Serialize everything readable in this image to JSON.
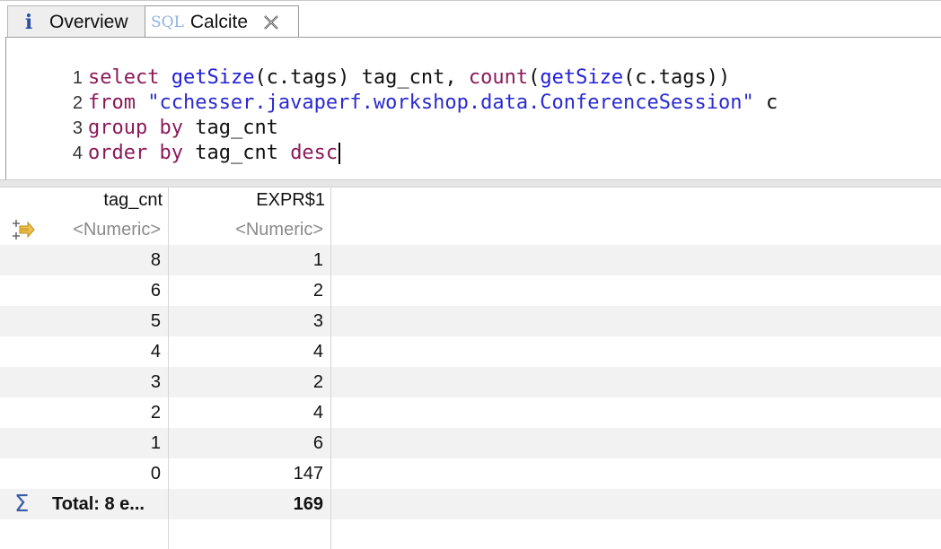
{
  "tabs": {
    "overview": {
      "icon": "info-icon",
      "label": "Overview"
    },
    "calcite": {
      "icon": "sql-icon",
      "icon_text": "SQL",
      "label": "Calcite"
    }
  },
  "editor": {
    "lines": [
      {
        "no": "1",
        "tokens": [
          "select",
          " ",
          "getSize",
          "(c.tags) tag_cnt, ",
          "count",
          "(",
          "getSize",
          "(c.tags))"
        ]
      },
      {
        "no": "2",
        "tokens": [
          "from",
          " ",
          "\"cchesser.javaperf.workshop.data.ConferenceSession\"",
          " c"
        ]
      },
      {
        "no": "3",
        "tokens": [
          "group",
          " ",
          "by",
          " tag_cnt"
        ]
      },
      {
        "no": "4",
        "tokens": [
          "order",
          " ",
          "by",
          " tag_cnt ",
          "desc"
        ]
      }
    ]
  },
  "grid": {
    "columns": [
      "tag_cnt",
      "EXPR$1"
    ],
    "filter_placeholder": [
      "<Numeric>",
      "<Numeric>"
    ],
    "rows": [
      [
        "8",
        "1"
      ],
      [
        "6",
        "2"
      ],
      [
        "5",
        "3"
      ],
      [
        "4",
        "4"
      ],
      [
        "3",
        "2"
      ],
      [
        "2",
        "4"
      ],
      [
        "1",
        "6"
      ],
      [
        "0",
        "147"
      ]
    ],
    "total": {
      "label": "Total: 8 e...",
      "value": "169"
    }
  },
  "colors": {
    "keyword": "#8b1a5a",
    "function": "#2020d8",
    "string": "#2a2ad0"
  }
}
